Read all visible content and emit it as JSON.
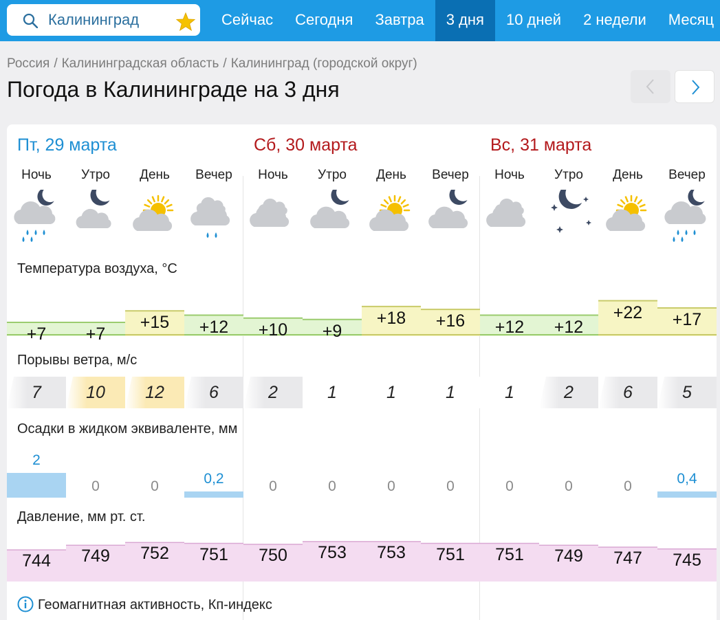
{
  "search": {
    "city": "Калининград"
  },
  "nav": {
    "tabs": [
      "Сейчас",
      "Сегодня",
      "Завтра",
      "3 дня",
      "10 дней",
      "2 недели",
      "Месяц"
    ],
    "active_index": 3
  },
  "breadcrumbs": [
    "Россия",
    "Калининградская область",
    "Калининград (городской округ)"
  ],
  "page_title": "Погода в Калининграде на 3 дня",
  "days": [
    {
      "label": "Пт, 29 марта",
      "color": "#1e8fd3"
    },
    {
      "label": "Сб, 30 марта",
      "color": "#b3191c"
    },
    {
      "label": "Вс, 31 марта",
      "color": "#b3191c"
    }
  ],
  "times_of_day": [
    "Ночь",
    "Утро",
    "День",
    "Вечер"
  ],
  "periods": [
    {
      "icon": "cloud-moon-rain-icon",
      "temp": "+7",
      "gust": "7",
      "precip": "2",
      "pressure": "744"
    },
    {
      "icon": "moon-cloud-icon",
      "temp": "+7",
      "gust": "10",
      "precip": "0",
      "pressure": "749"
    },
    {
      "icon": "sun-cloud-icon",
      "temp": "+15",
      "gust": "12",
      "precip": "0",
      "pressure": "752"
    },
    {
      "icon": "cloud-rain-icon",
      "temp": "+12",
      "gust": "6",
      "precip": "0,2",
      "pressure": "751"
    },
    {
      "icon": "cloudy-icon",
      "temp": "+10",
      "gust": "2",
      "precip": "0",
      "pressure": "750"
    },
    {
      "icon": "cloud-moon-icon",
      "temp": "+9",
      "gust": "1",
      "precip": "0",
      "pressure": "753"
    },
    {
      "icon": "sun-cloud-icon",
      "temp": "+18",
      "gust": "1",
      "precip": "0",
      "pressure": "753"
    },
    {
      "icon": "cloud-moon-icon",
      "temp": "+16",
      "gust": "1",
      "precip": "0",
      "pressure": "751"
    },
    {
      "icon": "cloudy-icon",
      "temp": "+12",
      "gust": "1",
      "precip": "0",
      "pressure": "751"
    },
    {
      "icon": "moon-stars-icon",
      "temp": "+12",
      "gust": "2",
      "precip": "0",
      "pressure": "749"
    },
    {
      "icon": "sun-cloud-icon",
      "temp": "+22",
      "gust": "6",
      "precip": "0",
      "pressure": "747"
    },
    {
      "icon": "cloud-moon-rain-icon",
      "temp": "+17",
      "gust": "5",
      "precip": "0,4",
      "pressure": "745"
    }
  ],
  "sections": {
    "temperature": "Температура воздуха, °С",
    "gusts": "Порывы ветра, м/с",
    "precipitation": "Осадки в жидком эквиваленте, мм",
    "pressure": "Давление, мм рт. ст.",
    "geomagnetic": "Геомагнитная активность, Кп-индекс"
  },
  "colors": {
    "nav_bg": "#1e9be4",
    "nav_active": "#0a6fb3",
    "temp_cool": "#e3f5d3",
    "temp_warm": "#f7f5c4",
    "gust_calm": "#e9e9eb",
    "gust_moderate": "#fbeab5",
    "precip": "#a9d4f2",
    "pressure": "#f4dcf1"
  }
}
